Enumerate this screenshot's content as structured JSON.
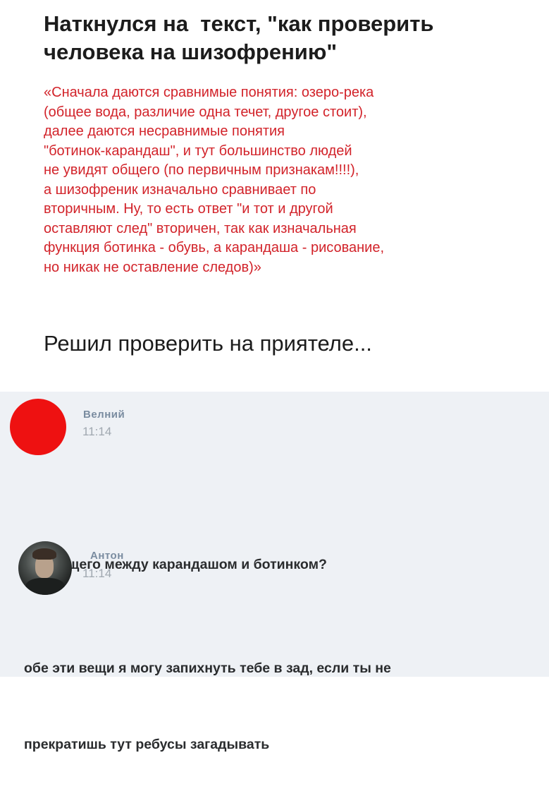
{
  "heading": {
    "line1": "Наткнулся на  текст, \"как проверить",
    "line2": "человека на шизофрению\""
  },
  "quote": {
    "lines": [
      "«Сначала даются сравнимые понятия: озеро-река",
      "(общее вода, различие одна течет, другое стоит),",
      "далее даются несравнимые понятия",
      "\"ботинок-карандаш\", и тут большинство людей",
      "не увидят общего (по первичным признакам!!!!),",
      "а шизофреник изначально сравнивает по",
      "вторичным. Ну, то есть ответ \"и тот и другой",
      "оставляют след\" вторичен, так как изначальная",
      "функция ботинка - обувь, а карандаша - рисование,",
      "но никак не оставление следов)»"
    ],
    "color": "#d2232a"
  },
  "subheading": "Решил проверить на приятеле...",
  "chat": {
    "messages": [
      {
        "author": "Велний",
        "time": "11:14",
        "text_lines": [
          "что общего между карандашом и ботинком?"
        ],
        "avatar": "red-circle",
        "avatar_color": "#ee1111"
      },
      {
        "author": "Антон",
        "time": "11:14",
        "text_lines": [
          "обе эти вещи я могу запихнуть тебе в зад, если ты не",
          "прекратишь тут ребусы загадывать"
        ],
        "avatar": "user-photo"
      }
    ]
  }
}
